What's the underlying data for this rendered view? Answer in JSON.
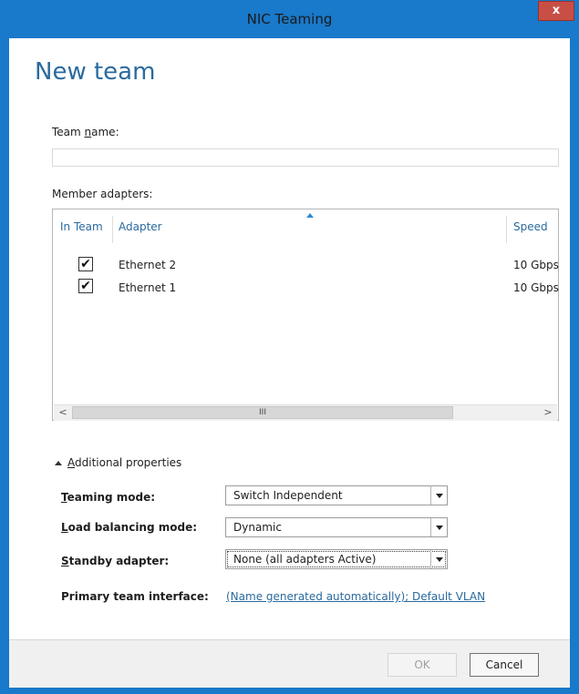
{
  "window": {
    "title": "NIC Teaming",
    "close_glyph": "x"
  },
  "page": {
    "heading": "New team"
  },
  "team_name": {
    "label_before": "Team ",
    "label_accel": "n",
    "label_after": "ame:",
    "value": ""
  },
  "member_adapters": {
    "label": "Member adapters:",
    "columns": {
      "in_team": "In Team",
      "adapter": "Adapter",
      "speed": "Speed"
    },
    "rows": [
      {
        "checked": "✔",
        "adapter": "Ethernet 2",
        "speed": "10 Gbps"
      },
      {
        "checked": "✔",
        "adapter": "Ethernet 1",
        "speed": "10 Gbps"
      }
    ],
    "scrollbar": {
      "left": "<",
      "right": ">",
      "grip": "III"
    }
  },
  "additional": {
    "accel": "A",
    "rest": "dditional properties"
  },
  "properties": {
    "teaming_mode": {
      "accel": "T",
      "rest": "eaming mode:",
      "value": "Switch Independent"
    },
    "load_balancing_mode": {
      "accel": "L",
      "rest": "oad balancing mode:",
      "value": "Dynamic"
    },
    "standby_adapter": {
      "accel": "S",
      "rest": "tandby adapter:",
      "value": "None (all adapters Active)"
    },
    "primary_team_interface": {
      "label": "Primary team interface:",
      "value": "(Name generated automatically); Default VLAN"
    }
  },
  "buttons": {
    "ok": "OK",
    "cancel": "Cancel"
  }
}
